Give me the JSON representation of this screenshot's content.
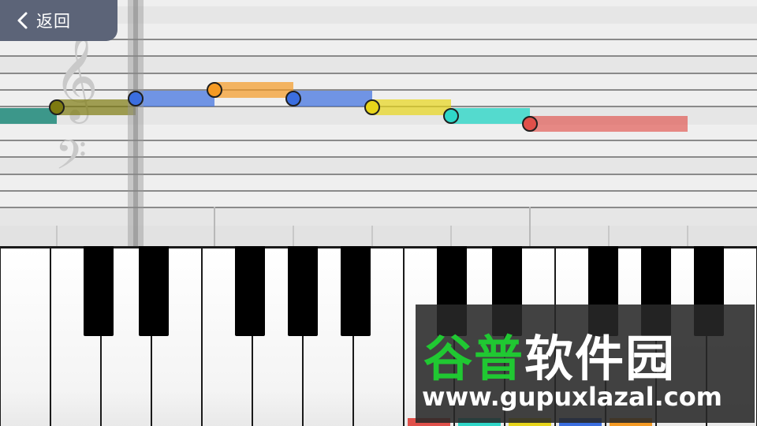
{
  "back_button": {
    "label": "返回",
    "icon": "chevron-left-icon"
  },
  "staff": {
    "treble_clef_glyph": "𝄞",
    "bass_clef_glyph": "𝄢"
  },
  "note_colors": {
    "olive": "#7d7a10",
    "blue": "#3b6ee0",
    "orange": "#f59a23",
    "yellow": "#e8d51a",
    "cyan": "#2fd7c8",
    "red": "#e0504a",
    "teal": "#3c978a"
  },
  "keyboard": {
    "highlight_colors": [
      "#e0504a",
      "#2fd7c8",
      "#e8d51a",
      "#3b6ee0",
      "#f59a23"
    ]
  },
  "watermark": {
    "logo_green": "谷普",
    "logo_white": "软件园",
    "url": "www.gupuxlazal.com"
  }
}
